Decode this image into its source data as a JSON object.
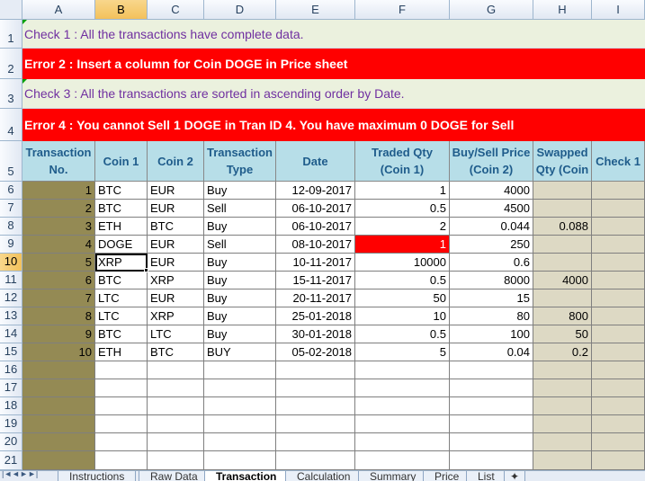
{
  "columns": [
    "A",
    "B",
    "C",
    "D",
    "E",
    "F",
    "G",
    "H",
    "I"
  ],
  "rows": [
    "1",
    "2",
    "3",
    "4",
    "5",
    "6",
    "7",
    "8",
    "9",
    "10",
    "11",
    "12",
    "13",
    "14",
    "15",
    "16",
    "17",
    "18",
    "19",
    "20",
    "21"
  ],
  "messages": [
    {
      "kind": "ok",
      "text": "Check 1 : All the transactions have complete data."
    },
    {
      "kind": "err",
      "text": "Error 2 : Insert a column for Coin DOGE in Price sheet"
    },
    {
      "kind": "ok",
      "text": "Check 3 : All the transactions are sorted in ascending order by Date."
    },
    {
      "kind": "err",
      "text": "Error 4 : You cannot Sell 1 DOGE in Tran ID 4. You have maximum 0 DOGE for Sell"
    }
  ],
  "table_headers": [
    "Transaction No.",
    "Coin 1",
    "Coin 2",
    "Transaction Type",
    "Date",
    "Traded Qty (Coin 1)",
    "Buy/Sell Price (Coin 2)",
    "Swapped Qty (Coin",
    "Check 1"
  ],
  "table_rows": [
    [
      "1",
      "BTC",
      "EUR",
      "Buy",
      "12-09-2017",
      "1",
      "4000",
      "",
      ""
    ],
    [
      "2",
      "BTC",
      "EUR",
      "Sell",
      "06-10-2017",
      "0.5",
      "4500",
      "",
      ""
    ],
    [
      "3",
      "ETH",
      "BTC",
      "Buy",
      "06-10-2017",
      "2",
      "0.044",
      "0.088",
      ""
    ],
    [
      "4",
      "DOGE",
      "EUR",
      "Sell",
      "08-10-2017",
      "1",
      "250",
      "",
      ""
    ],
    [
      "5",
      "XRP",
      "EUR",
      "Buy",
      "10-11-2017",
      "10000",
      "0.6",
      "",
      ""
    ],
    [
      "6",
      "BTC",
      "XRP",
      "Buy",
      "15-11-2017",
      "0.5",
      "8000",
      "4000",
      ""
    ],
    [
      "7",
      "LTC",
      "EUR",
      "Buy",
      "20-11-2017",
      "50",
      "15",
      "",
      ""
    ],
    [
      "8",
      "LTC",
      "XRP",
      "Buy",
      "25-01-2018",
      "10",
      "80",
      "800",
      ""
    ],
    [
      "9",
      "BTC",
      "LTC",
      "Buy",
      "30-01-2018",
      "0.5",
      "100",
      "50",
      ""
    ],
    [
      "10",
      "ETH",
      "BTC",
      "BUY",
      "05-02-2018",
      "5",
      "0.04",
      "0.2",
      ""
    ]
  ],
  "empty_row_count": 6,
  "selected_cell": "B10",
  "error_cell": "F9",
  "sheet_tabs": [
    "Instructions",
    "Raw Data",
    "Transaction",
    "Calculation",
    "Summary",
    "Price",
    "List"
  ],
  "active_tab": "Transaction",
  "nav_icons": [
    "first-sheet-icon",
    "prev-sheet-icon",
    "next-sheet-icon",
    "last-sheet-icon",
    "new-sheet-icon"
  ],
  "colors": {
    "check_bg": "#ebf1de",
    "check_text": "#7030a0",
    "error_bg": "#ff0000",
    "header_bg": "#b7dee8",
    "olive": "#948a54",
    "tan": "#ddd9c4"
  }
}
